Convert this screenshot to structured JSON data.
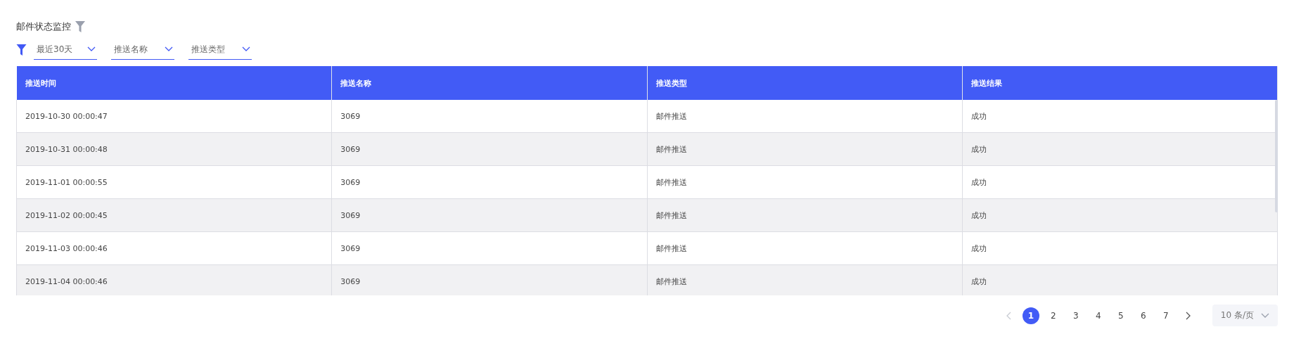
{
  "title": "邮件状态监控",
  "filters": [
    {
      "value": "最近30天"
    },
    {
      "value": "推送名称"
    },
    {
      "value": "推送类型"
    }
  ],
  "table": {
    "columns": [
      "推送时间",
      "推送名称",
      "推送类型",
      "推送结果"
    ],
    "rows": [
      [
        "2019-10-30 00:00:47",
        "3069",
        "邮件推送",
        "成功"
      ],
      [
        "2019-10-31 00:00:48",
        "3069",
        "邮件推送",
        "成功"
      ],
      [
        "2019-11-01 00:00:55",
        "3069",
        "邮件推送",
        "成功"
      ],
      [
        "2019-11-02 00:00:45",
        "3069",
        "邮件推送",
        "成功"
      ],
      [
        "2019-11-03 00:00:46",
        "3069",
        "邮件推送",
        "成功"
      ],
      [
        "2019-11-04 00:00:46",
        "3069",
        "邮件推送",
        "成功"
      ]
    ]
  },
  "pagination": {
    "pages": [
      {
        "label": "1",
        "selected": true
      },
      {
        "label": "2",
        "selected": false
      },
      {
        "label": "3",
        "selected": false
      },
      {
        "label": "4",
        "selected": false
      },
      {
        "label": "5",
        "selected": false
      },
      {
        "label": "6",
        "selected": false
      },
      {
        "label": "7",
        "selected": false
      }
    ],
    "page_size": "10 条/页"
  }
}
